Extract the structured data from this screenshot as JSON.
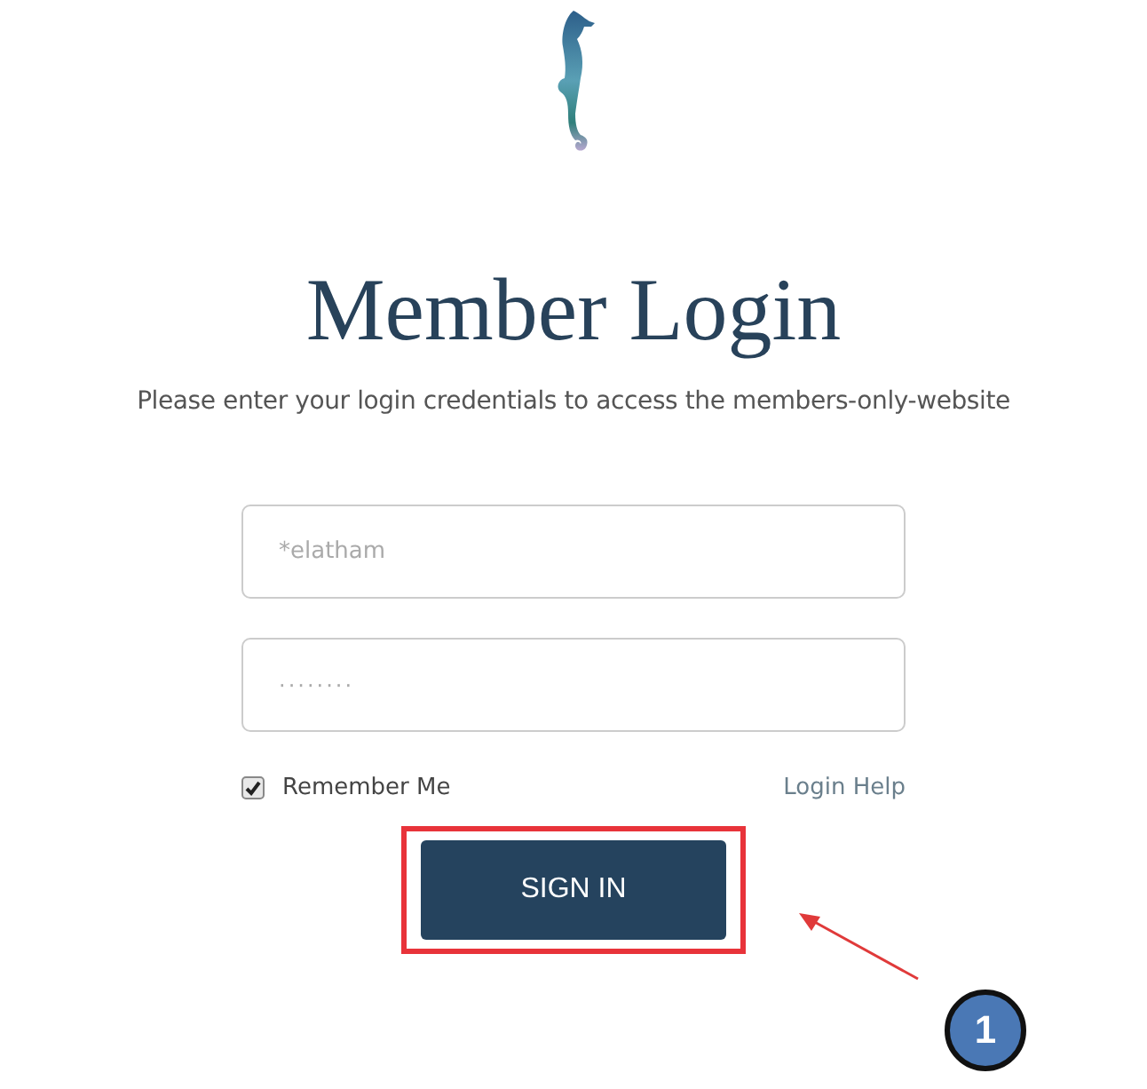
{
  "title": "Member Login",
  "subtitle": "Please enter your login credentials to access the members-only-website",
  "fields": [
    {
      "kind": "username",
      "value": "*elatham"
    },
    {
      "kind": "password",
      "value": "········"
    }
  ],
  "remember": {
    "label": "Remember Me",
    "checked": true
  },
  "help_link": "Login Help",
  "submit": {
    "label": "SIGN IN",
    "highlighted": true
  },
  "callout": {
    "label": "1"
  }
}
